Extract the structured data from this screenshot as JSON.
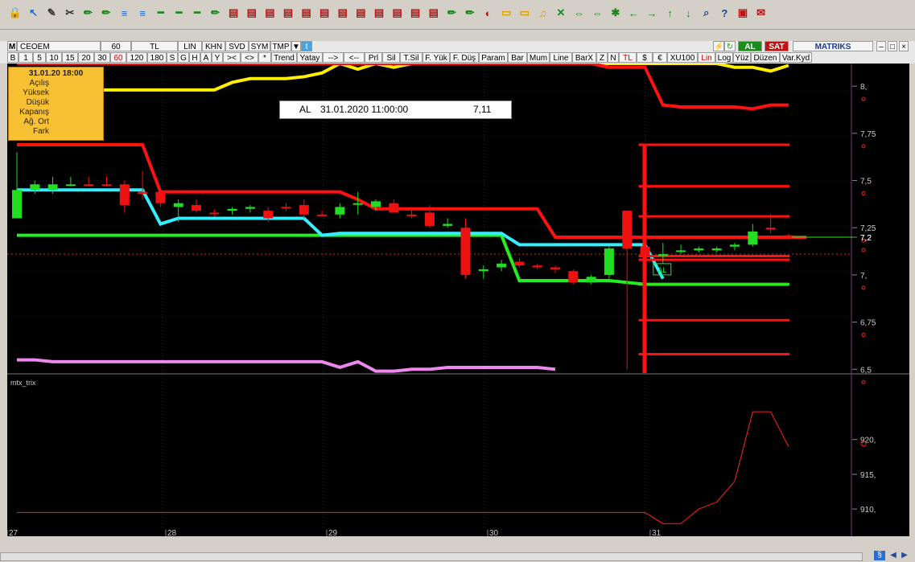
{
  "toolbar": {
    "icons": [
      "lock-icon",
      "arrow-icon",
      "edit-icon",
      "tools-icon",
      "pencil-icon",
      "pencil-icon",
      "align-icon",
      "align-icon",
      "line-icon",
      "line-icon",
      "line-icon",
      "pencil-icon",
      "chart-icon",
      "chart-icon",
      "chart-icon",
      "chart-icon",
      "chart-icon",
      "chart-icon",
      "chart-icon",
      "chart-icon",
      "chart-icon",
      "chart-icon",
      "chart-icon",
      "chart-icon",
      "pencil-icon",
      "pencil-icon",
      "paint-icon",
      "note-icon",
      "note-icon",
      "bell-icon",
      "cross-icon",
      "swap-icon",
      "swap-icon",
      "star-icon",
      "arrow-left-icon",
      "arrow-right-icon",
      "arrow-up-icon",
      "arrow-down-icon",
      "search-icon",
      "help-icon",
      "image-icon",
      "envelope-icon"
    ]
  },
  "symbolbar": {
    "m_label": "M",
    "symbol": "CEOEM",
    "period": "60",
    "currency": "TL",
    "buttons": [
      "LIN",
      "KHN",
      "SVD",
      "SYM",
      "TMP"
    ],
    "buy": "AL",
    "sell": "SAT",
    "brand": "MATRIKS"
  },
  "periodbar": {
    "items": [
      "B",
      "1",
      "5",
      "10",
      "15",
      "20",
      "30",
      "60",
      "120",
      "180",
      "S",
      "G",
      "H",
      "A",
      "Y",
      "><",
      "<>",
      "*",
      "Trend",
      "Yatay",
      "-->",
      "<--",
      "Prl",
      "Sil",
      "T.Sil",
      "F. Yük",
      "F. Düş",
      "Param",
      "Bar",
      "Mum",
      "Line",
      "BarX",
      "Z",
      "N",
      "TL",
      "$",
      "€",
      "XU100",
      "Lin",
      "Log",
      "Yüz",
      "Düzen",
      "Var.Kyd"
    ]
  },
  "info_box": {
    "date": "31.01.20 18:00",
    "fields": [
      "Açılış",
      "Yüksek",
      "Düşük",
      "Kapanış",
      "Ağ. Ort",
      "Fark"
    ]
  },
  "tooltip": {
    "side": "AL",
    "datetime": "31.01.2020 11:00:00",
    "value": "7,11"
  },
  "chart_data": [
    {
      "type": "candlestick",
      "y_axis": {
        "ticks": [
          "8,",
          "7,75",
          "7,5",
          "7,25",
          "7,2",
          "7,",
          "6,75",
          "6,5"
        ],
        "ylim": [
          6.48,
          8.12
        ]
      },
      "x_axis": {
        "ticks": [
          "27",
          "28",
          "29",
          "30",
          "31"
        ]
      },
      "current_price_label": "7,2",
      "signal_label": "AL",
      "candles": [
        {
          "o": 7.45,
          "h": 7.65,
          "l": 7.3,
          "c": 7.3,
          "dir": "up"
        },
        {
          "o": 7.45,
          "h": 7.5,
          "l": 7.43,
          "c": 7.48,
          "dir": "up"
        },
        {
          "o": 7.45,
          "h": 7.52,
          "l": 7.43,
          "c": 7.48,
          "dir": "up"
        },
        {
          "o": 7.48,
          "h": 7.52,
          "l": 7.47,
          "c": 7.48,
          "dir": "up"
        },
        {
          "o": 7.48,
          "h": 7.52,
          "l": 7.47,
          "c": 7.48,
          "dir": "down"
        },
        {
          "o": 7.48,
          "h": 7.52,
          "l": 7.47,
          "c": 7.48,
          "dir": "down"
        },
        {
          "o": 7.48,
          "h": 7.5,
          "l": 7.33,
          "c": 7.37,
          "dir": "down"
        },
        {
          "o": 7.44,
          "h": 7.55,
          "l": 7.4,
          "c": 7.43,
          "dir": "down"
        },
        {
          "o": 7.44,
          "h": 7.46,
          "l": 7.36,
          "c": 7.38,
          "dir": "down"
        },
        {
          "o": 7.36,
          "h": 7.4,
          "l": 7.28,
          "c": 7.38,
          "dir": "up"
        },
        {
          "o": 7.37,
          "h": 7.4,
          "l": 7.33,
          "c": 7.34,
          "dir": "down"
        },
        {
          "o": 7.33,
          "h": 7.35,
          "l": 7.31,
          "c": 7.33,
          "dir": "down"
        },
        {
          "o": 7.34,
          "h": 7.36,
          "l": 7.32,
          "c": 7.35,
          "dir": "up"
        },
        {
          "o": 7.35,
          "h": 7.37,
          "l": 7.33,
          "c": 7.36,
          "dir": "up"
        },
        {
          "o": 7.34,
          "h": 7.36,
          "l": 7.28,
          "c": 7.3,
          "dir": "down"
        },
        {
          "o": 7.36,
          "h": 7.38,
          "l": 7.34,
          "c": 7.36,
          "dir": "down"
        },
        {
          "o": 7.37,
          "h": 7.4,
          "l": 7.3,
          "c": 7.32,
          "dir": "down"
        },
        {
          "o": 7.32,
          "h": 7.34,
          "l": 7.31,
          "c": 7.32,
          "dir": "down"
        },
        {
          "o": 7.32,
          "h": 7.38,
          "l": 7.3,
          "c": 7.36,
          "dir": "up"
        },
        {
          "o": 7.38,
          "h": 7.44,
          "l": 7.32,
          "c": 7.38,
          "dir": "up"
        },
        {
          "o": 7.36,
          "h": 7.4,
          "l": 7.34,
          "c": 7.39,
          "dir": "up"
        },
        {
          "o": 7.38,
          "h": 7.4,
          "l": 7.33,
          "c": 7.33,
          "dir": "down"
        },
        {
          "o": 7.32,
          "h": 7.36,
          "l": 7.3,
          "c": 7.32,
          "dir": "down"
        },
        {
          "o": 7.33,
          "h": 7.37,
          "l": 7.25,
          "c": 7.26,
          "dir": "down"
        },
        {
          "o": 7.26,
          "h": 7.3,
          "l": 7.25,
          "c": 7.27,
          "dir": "up"
        },
        {
          "o": 7.25,
          "h": 7.3,
          "l": 6.98,
          "c": 7.0,
          "dir": "down"
        },
        {
          "o": 7.02,
          "h": 7.05,
          "l": 6.98,
          "c": 7.03,
          "dir": "up"
        },
        {
          "o": 7.04,
          "h": 7.08,
          "l": 7.02,
          "c": 7.06,
          "dir": "up"
        },
        {
          "o": 7.07,
          "h": 7.09,
          "l": 7.04,
          "c": 7.05,
          "dir": "down"
        },
        {
          "o": 7.05,
          "h": 7.06,
          "l": 7.03,
          "c": 7.04,
          "dir": "down"
        },
        {
          "o": 7.04,
          "h": 7.05,
          "l": 7.01,
          "c": 7.03,
          "dir": "down"
        },
        {
          "o": 7.02,
          "h": 7.03,
          "l": 6.95,
          "c": 6.96,
          "dir": "down"
        },
        {
          "o": 6.96,
          "h": 7.0,
          "l": 6.95,
          "c": 6.99,
          "dir": "up"
        },
        {
          "o": 7.0,
          "h": 7.15,
          "l": 6.98,
          "c": 7.14,
          "dir": "up"
        },
        {
          "o": 7.34,
          "h": 7.34,
          "l": 6.5,
          "c": 7.14,
          "dir": "down"
        },
        {
          "o": 7.15,
          "h": 7.18,
          "l": 7.06,
          "c": 7.1,
          "dir": "down"
        },
        {
          "o": 7.1,
          "h": 7.17,
          "l": 7.06,
          "c": 7.11,
          "dir": "up"
        },
        {
          "o": 7.13,
          "h": 7.16,
          "l": 7.11,
          "c": 7.13,
          "dir": "up"
        },
        {
          "o": 7.13,
          "h": 7.15,
          "l": 7.12,
          "c": 7.14,
          "dir": "up"
        },
        {
          "o": 7.14,
          "h": 7.15,
          "l": 7.12,
          "c": 7.13,
          "dir": "up"
        },
        {
          "o": 7.15,
          "h": 7.17,
          "l": 7.13,
          "c": 7.16,
          "dir": "up"
        },
        {
          "o": 7.16,
          "h": 7.27,
          "l": 7.15,
          "c": 7.23,
          "dir": "up"
        },
        {
          "o": 7.25,
          "h": 7.32,
          "l": 7.22,
          "c": 7.24,
          "dir": "down"
        },
        {
          "o": 7.21,
          "h": 7.22,
          "l": 7.2,
          "c": 7.21,
          "dir": "down"
        }
      ],
      "lines": {
        "yellow": [
          7.98,
          7.98,
          7.98,
          7.98,
          7.98,
          7.98,
          7.98,
          7.98,
          7.98,
          7.98,
          7.98,
          7.98,
          8.02,
          8.04,
          8.04,
          8.04,
          8.05,
          8.07,
          8.12,
          8.09,
          8.12,
          8.1,
          8.12,
          8.12,
          8.12,
          8.12,
          8.12,
          8.12,
          8.12,
          8.12,
          8.12,
          8.12,
          8.12,
          8.12,
          8.12,
          8.12,
          8.12,
          8.12,
          8.12,
          8.12,
          8.1,
          8.1,
          8.08,
          8.11
        ],
        "red_upper": [
          8.12,
          8.12,
          8.12,
          8.12,
          8.12,
          8.12,
          8.12,
          8.12,
          8.12,
          8.12,
          8.12,
          8.12,
          8.12,
          8.12,
          8.12,
          8.12,
          8.12,
          8.12,
          8.12,
          8.12,
          8.12,
          8.12,
          8.12,
          8.12,
          8.12,
          8.12,
          8.12,
          8.12,
          8.12,
          8.12,
          8.12,
          8.12,
          8.12,
          8.1,
          8.1,
          8.1,
          7.9,
          7.89,
          7.89,
          7.89,
          7.89,
          7.88,
          7.9,
          7.9
        ],
        "red_band": [
          7.69,
          7.69,
          7.69,
          7.69,
          7.69,
          7.69,
          7.69,
          7.69,
          7.44,
          7.44,
          7.44,
          7.44,
          7.44,
          7.44,
          7.44,
          7.44,
          7.44,
          7.44,
          7.44,
          7.4,
          7.35,
          7.35,
          7.35,
          7.35,
          7.35,
          7.35,
          7.35,
          7.35,
          7.35,
          7.35,
          7.2,
          7.2,
          7.2,
          7.2,
          7.2,
          7.2,
          7.2,
          7.2,
          7.2,
          7.2,
          7.2,
          7.2,
          7.2,
          7.2,
          7.2
        ],
        "cyan": [
          7.45,
          7.45,
          7.45,
          7.45,
          7.45,
          7.45,
          7.45,
          7.45,
          7.27,
          7.3,
          7.3,
          7.3,
          7.3,
          7.3,
          7.3,
          7.3,
          7.3,
          7.21,
          7.22,
          7.22,
          7.22,
          7.22,
          7.22,
          7.22,
          7.22,
          7.22,
          7.22,
          7.22,
          7.16,
          7.16,
          7.16,
          7.16,
          7.16,
          7.16,
          7.16,
          7.16,
          6.98
        ],
        "green": [
          7.21,
          7.21,
          7.21,
          7.21,
          7.21,
          7.21,
          7.21,
          7.21,
          7.21,
          7.21,
          7.21,
          7.21,
          7.21,
          7.21,
          7.21,
          7.21,
          7.21,
          7.21,
          7.21,
          7.21,
          7.21,
          7.21,
          7.21,
          7.21,
          7.21,
          7.21,
          7.21,
          7.21,
          6.97,
          6.97,
          6.97,
          6.97,
          6.97,
          6.97,
          6.96,
          6.95,
          6.95,
          6.95,
          6.95,
          6.95,
          6.95,
          6.95,
          6.95,
          6.95
        ],
        "pink": [
          6.55,
          6.55,
          6.54,
          6.54,
          6.54,
          6.54,
          6.54,
          6.54,
          6.54,
          6.54,
          6.54,
          6.54,
          6.54,
          6.54,
          6.54,
          6.54,
          6.54,
          6.54,
          6.51,
          6.54,
          6.49,
          6.49,
          6.5,
          6.5,
          6.51,
          6.51,
          6.51,
          6.51,
          6.51,
          6.51,
          6.5
        ]
      },
      "levels": [
        7.69,
        7.47,
        7.31,
        7.08,
        6.95,
        6.76,
        6.58
      ],
      "level_marker": 7.1,
      "colors": {
        "up": "#22dd22",
        "down": "#ee1111",
        "yellow": "#ffee00",
        "red": "#ff1111",
        "cyan": "#33eeff",
        "green": "#22ee22",
        "pink": "#ee88ee"
      }
    },
    {
      "type": "line",
      "title": "mtx_trix",
      "y_axis": {
        "ticks": [
          "920,",
          "915,",
          "910,"
        ],
        "ylim": [
          907,
          929
        ]
      },
      "values": [
        909.5,
        909.5,
        909.5,
        909.5,
        909.5,
        909.5,
        909.5,
        909.5,
        909.5,
        909.5,
        909.5,
        909.5,
        909.5,
        909.5,
        909.5,
        909.5,
        909.5,
        909.5,
        909.5,
        909.5,
        909.5,
        909.5,
        909.5,
        909.5,
        909.5,
        909.5,
        909.5,
        909.5,
        909.5,
        909.5,
        909.5,
        909.5,
        909.5,
        909.5,
        909.5,
        909.5,
        907.9,
        907.9,
        910,
        911,
        914,
        924,
        924,
        919
      ],
      "color": "#ff2222"
    }
  ]
}
